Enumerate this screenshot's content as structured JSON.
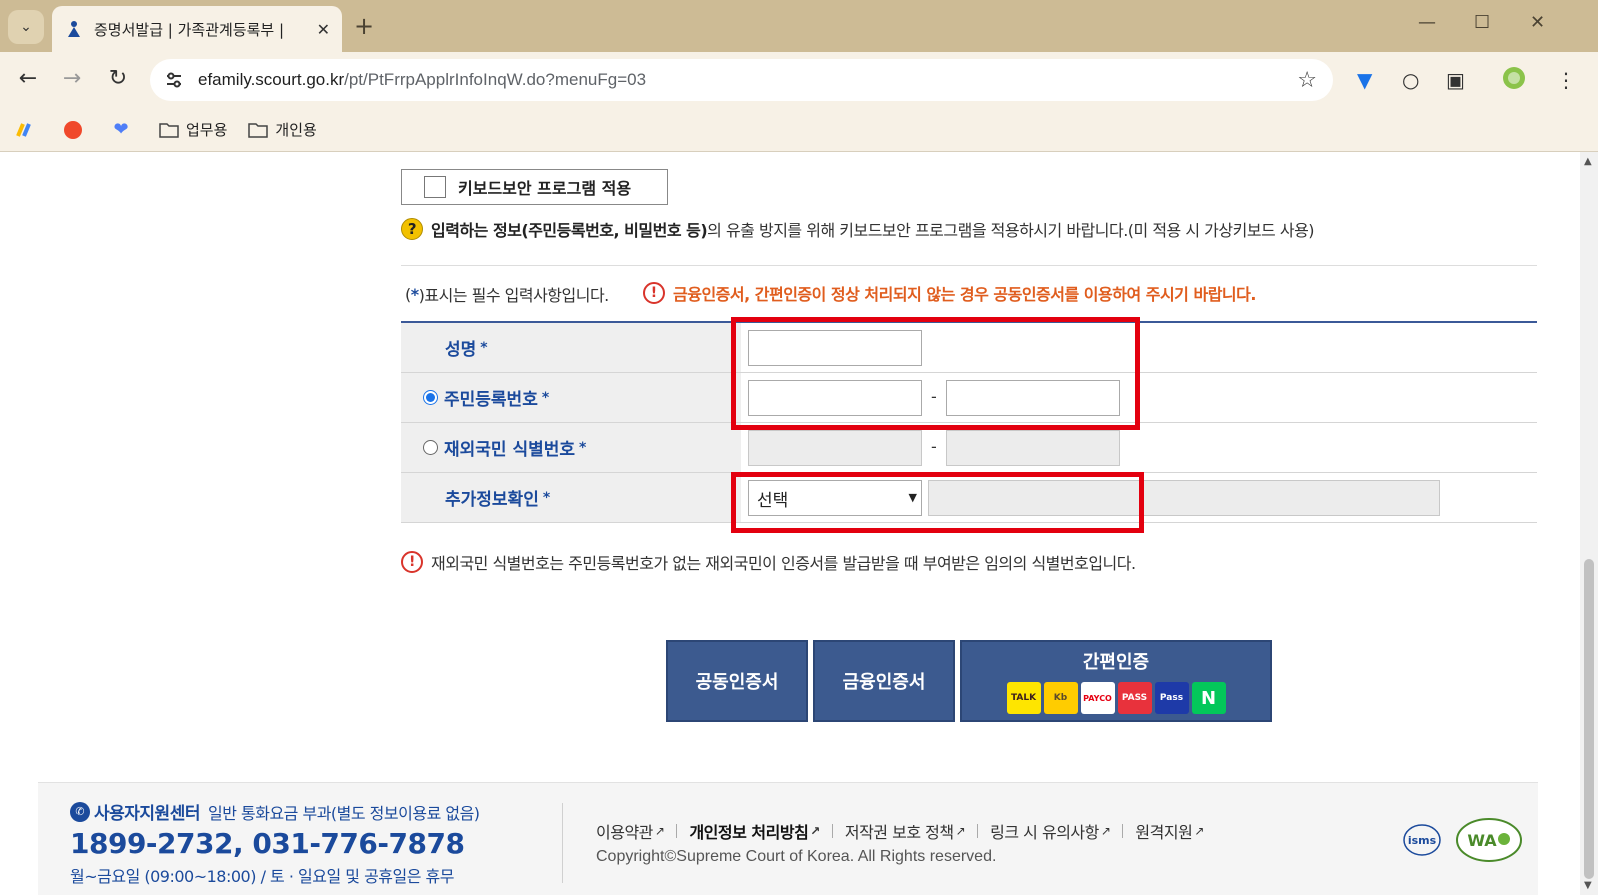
{
  "browser": {
    "tab_title": "증명서발급 | 가족관계등록부 |",
    "url_host": "efamily.scourt.go.kr",
    "url_path": "/pt/PtFrrpApplrInfoInqW.do?menuFg=03",
    "bookmarks": [
      {
        "label": ""
      },
      {
        "label": ""
      },
      {
        "label": ""
      },
      {
        "label": "업무용"
      },
      {
        "label": "개인용"
      }
    ]
  },
  "keyboard_security": {
    "label": "키보드보안 프로그램 적용",
    "notice_bold": "입력하는 정보(주민등록번호, 비밀번호 등)",
    "notice_rest": "의 유출 방지를 위해 키보드보안 프로그램을 적용하시기 바랍니다.(미 적용 시 가상키보드 사용)"
  },
  "required_note": {
    "open": "(",
    "star": "*",
    "rest": ")표시는 필수 입력사항입니다."
  },
  "warning": "금융인증서, 간편인증이 정상 처리되지 않는 경우 공동인증서를 이용하여 주시기 바랍니다.",
  "form": {
    "name_label": "성명",
    "rrn_label": "주민등록번호",
    "foreign_label": "재외국민 식별번호",
    "extra_label": "추가정보확인",
    "required_mark": "*",
    "dash": "-",
    "select_value": "선택"
  },
  "info_note": "재외국민 식별번호는 주민등록번호가 없는 재외국민이 인증서를 발급받을 때 부여받은 임의의 식별번호입니다.",
  "buttons": {
    "joint_cert": "공동인증서",
    "finance_cert": "금융인증서",
    "simple_auth": "간편인증",
    "logos": [
      "TALK",
      "Kb",
      "PAYCO",
      "PASS",
      "Pass",
      "N"
    ]
  },
  "footer": {
    "center_title": "사용자지원센터",
    "center_sub": "일반 통화요금 부과(별도 정보이용료 없음)",
    "phone": "1899-2732, 031-776-7878",
    "hours": "월~금요일 (09:00~18:00) / 토 · 일요일 및 공휴일은 휴무",
    "links": [
      "이용약관",
      "개인정보 처리방침",
      "저작권 보호 정책",
      "링크 시 유의사항",
      "원격지원"
    ],
    "copyright": "Copyright©Supreme Court of Korea. All Rights reserved.",
    "cert1": "isms",
    "cert2": "WA"
  },
  "colors": {
    "accent_blue": "#1b4a9c",
    "button_blue": "#3c5a8f",
    "warning_orange": "#e05d1e",
    "highlight_red": "#e3000f"
  }
}
